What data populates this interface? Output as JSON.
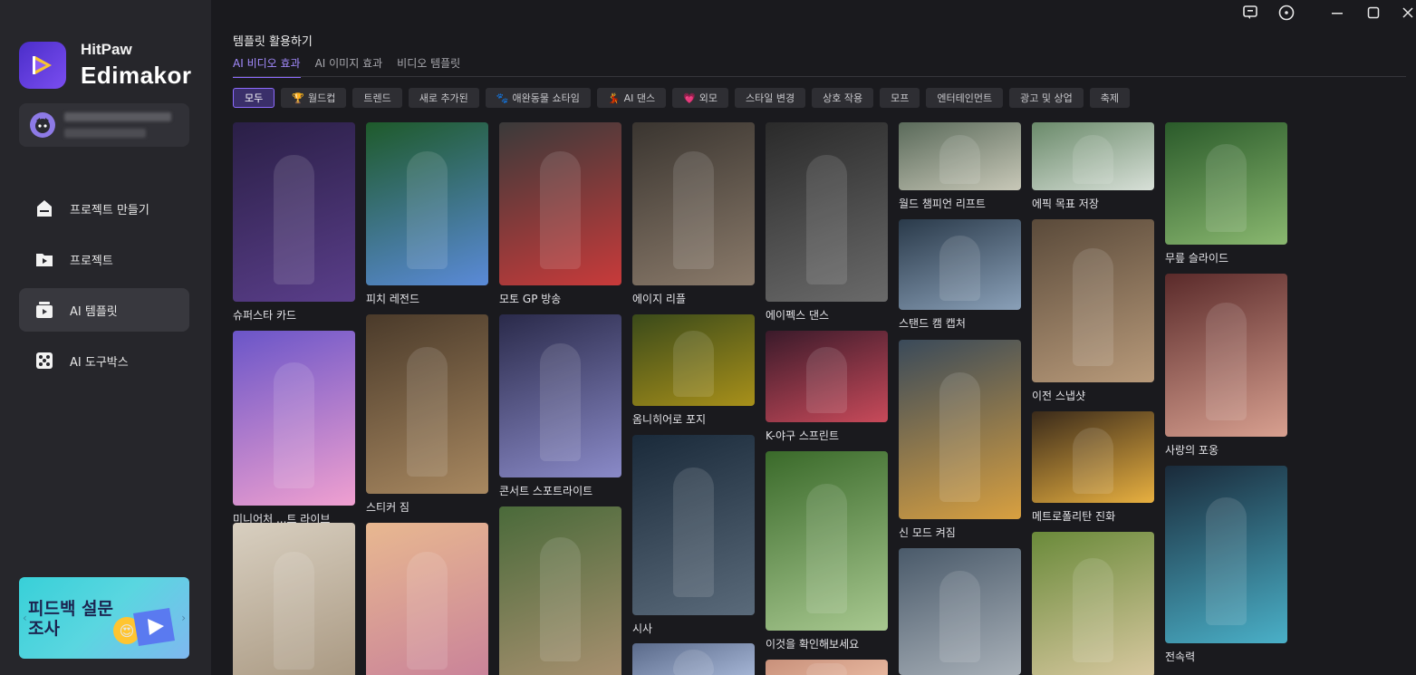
{
  "app": {
    "brand_top": "HitPaw",
    "brand_bottom": "Edimakor"
  },
  "sidebar": {
    "items": [
      {
        "label": "프로젝트 만들기",
        "icon": "upload-icon"
      },
      {
        "label": "프로젝트",
        "icon": "folder-icon"
      },
      {
        "label": "AI 템플릿",
        "icon": "template-icon"
      },
      {
        "label": "AI 도구박스",
        "icon": "toolbox-icon"
      }
    ],
    "promo": {
      "text": "피드백 설문조사"
    }
  },
  "main": {
    "title": "템플릿 활용하기",
    "tabs": [
      {
        "label": "AI 비디오 효과",
        "active": true
      },
      {
        "label": "AI 이미지 효과",
        "active": false
      },
      {
        "label": "비디오 템플릿",
        "active": false
      }
    ],
    "chips": [
      {
        "label": "모두",
        "active": true,
        "icon": ""
      },
      {
        "label": "월드컵",
        "active": false,
        "icon": "🏆"
      },
      {
        "label": "트렌드",
        "active": false,
        "icon": ""
      },
      {
        "label": "새로 추가된",
        "active": false,
        "icon": ""
      },
      {
        "label": "애완동물 쇼타임",
        "active": false,
        "icon": "🐾"
      },
      {
        "label": "AI 댄스",
        "active": false,
        "icon": "💃"
      },
      {
        "label": "외모",
        "active": false,
        "icon": "💗"
      },
      {
        "label": "스타일 변경",
        "active": false,
        "icon": ""
      },
      {
        "label": "상호 작용",
        "active": false,
        "icon": ""
      },
      {
        "label": "모프",
        "active": false,
        "icon": ""
      },
      {
        "label": "엔터테인먼트",
        "active": false,
        "icon": ""
      },
      {
        "label": "광고 및 상업",
        "active": false,
        "icon": ""
      },
      {
        "label": "축제",
        "active": false,
        "icon": ""
      }
    ],
    "cards": [
      {
        "label": "슈퍼스타 카드",
        "colors": [
          "#2a1f46",
          "#5a3e8a"
        ]
      },
      {
        "label": "미니어처 ...트 라이브",
        "colors": [
          "#6a55c8",
          "#f0a0d0"
        ]
      },
      {
        "label": "",
        "colors": [
          "#d8cfc0",
          "#a89780"
        ]
      },
      {
        "label": "피치 레전드",
        "colors": [
          "#1e5a2a",
          "#5a8ad8"
        ]
      },
      {
        "label": "스티커 짐",
        "colors": [
          "#4a3a2a",
          "#a88860"
        ]
      },
      {
        "label": "",
        "colors": [
          "#e8b890",
          "#c8809a"
        ]
      },
      {
        "label": "모토 GP 방송",
        "colors": [
          "#3a3a3a",
          "#c83a3a"
        ]
      },
      {
        "label": "콘서트 스포트라이트",
        "colors": [
          "#2a2a4a",
          "#8a8ac8"
        ]
      },
      {
        "label": "",
        "colors": [
          "#4a6a3a",
          "#a89070"
        ]
      },
      {
        "label": "에이지 리플",
        "colors": [
          "#3a3530",
          "#8a7a6a"
        ]
      },
      {
        "label": "옴니히어로 포지",
        "colors": [
          "#3a4a1a",
          "#a8901a"
        ]
      },
      {
        "label": "시사",
        "colors": [
          "#1a2a3a",
          "#5a6a7a"
        ]
      },
      {
        "label": "",
        "colors": [
          "#5a6a8a",
          "#a8b8d8"
        ]
      },
      {
        "label": "에이펙스 댄스",
        "colors": [
          "#2a2a2a",
          "#6a6a6a"
        ]
      },
      {
        "label": "K-야구 스프린트",
        "colors": [
          "#3a1a2a",
          "#c84a5a"
        ]
      },
      {
        "label": "이것을 확인해보세요",
        "colors": [
          "#3a6a2a",
          "#a8c890"
        ]
      },
      {
        "label": "",
        "colors": [
          "#c8907a",
          "#e8b8a0"
        ]
      },
      {
        "label": "월드 챔피언 리프트",
        "colors": [
          "#5a6a5a",
          "#c8c8b8"
        ]
      },
      {
        "label": "스탠드 캠 캡처",
        "colors": [
          "#2a3a4a",
          "#8aa0b8"
        ]
      },
      {
        "label": "신 모드 켜짐",
        "colors": [
          "#3a4a5a",
          "#d8a040"
        ]
      },
      {
        "label": "",
        "colors": [
          "#4a5a6a",
          "#a8b0b8"
        ]
      },
      {
        "label": "에픽 목표 저장",
        "colors": [
          "#6a8a6a",
          "#d8e0d8"
        ]
      },
      {
        "label": "이전 스냅샷",
        "colors": [
          "#5a4a3a",
          "#b89a7a"
        ]
      },
      {
        "label": "메트로폴리탄 진화",
        "colors": [
          "#3a2a1a",
          "#e8b040"
        ]
      },
      {
        "label": "",
        "colors": [
          "#6a8a3a",
          "#d8c8a0"
        ]
      },
      {
        "label": "무릎 슬라이드",
        "colors": [
          "#2a5a2a",
          "#8ab870"
        ]
      },
      {
        "label": "사랑의 포옹",
        "colors": [
          "#5a2a2a",
          "#d8a090"
        ]
      },
      {
        "label": "전속력",
        "colors": [
          "#1a2a3a",
          "#4ab0c8"
        ]
      }
    ]
  }
}
